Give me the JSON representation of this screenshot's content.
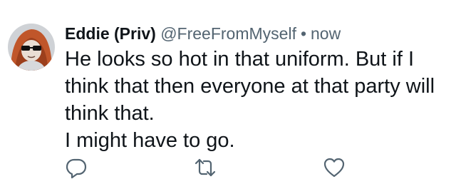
{
  "tweet": {
    "display_name": "Eddie (Priv)",
    "handle": "@FreeFromMyself",
    "separator": "•",
    "timestamp": "now",
    "text_lines": [
      "He looks so hot in that uniform. But if I",
      "think that then everyone at that party will",
      "think that.",
      "I might have to go."
    ]
  },
  "actions": [
    {
      "icon": "reply-icon"
    },
    {
      "icon": "retweet-icon"
    },
    {
      "icon": "like-icon"
    }
  ],
  "colors": {
    "text": "#0f1419",
    "secondary": "#536471",
    "avatar_hood": "#c0562a"
  }
}
